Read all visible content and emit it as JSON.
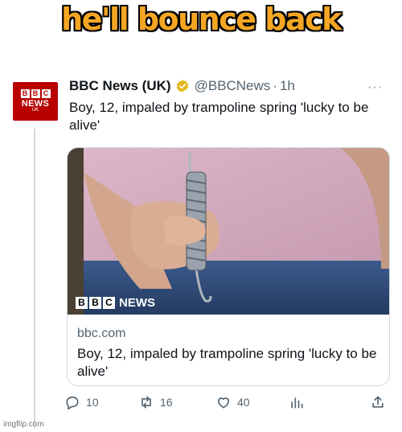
{
  "caption": "he'll bounce back",
  "tweet": {
    "avatar": {
      "blocks": [
        "B",
        "B",
        "C"
      ],
      "line1": "NEWS",
      "line2": "UK"
    },
    "author_name": "BBC News (UK)",
    "handle": "@BBCNews",
    "separator": "·",
    "time": "1h",
    "more": "···",
    "text": "Boy, 12, impaled by trampoline spring 'lucky to be alive'",
    "card": {
      "logo_blocks": [
        "B",
        "B",
        "C"
      ],
      "logo_word": "NEWS",
      "domain": "bbc.com",
      "title": "Boy, 12, impaled by trampoline spring 'lucky to be alive'"
    },
    "actions": {
      "replies": "10",
      "retweets": "16",
      "likes": "40"
    }
  },
  "watermark": "imgflip.com",
  "colors": {
    "caption": "#f5a623",
    "bbc_red": "#b80000",
    "verified_gold": "#e2b719",
    "muted": "#536471"
  },
  "icons": [
    "reply-icon",
    "retweet-icon",
    "like-icon",
    "views-icon",
    "share-icon",
    "verified-badge-icon",
    "more-icon"
  ]
}
